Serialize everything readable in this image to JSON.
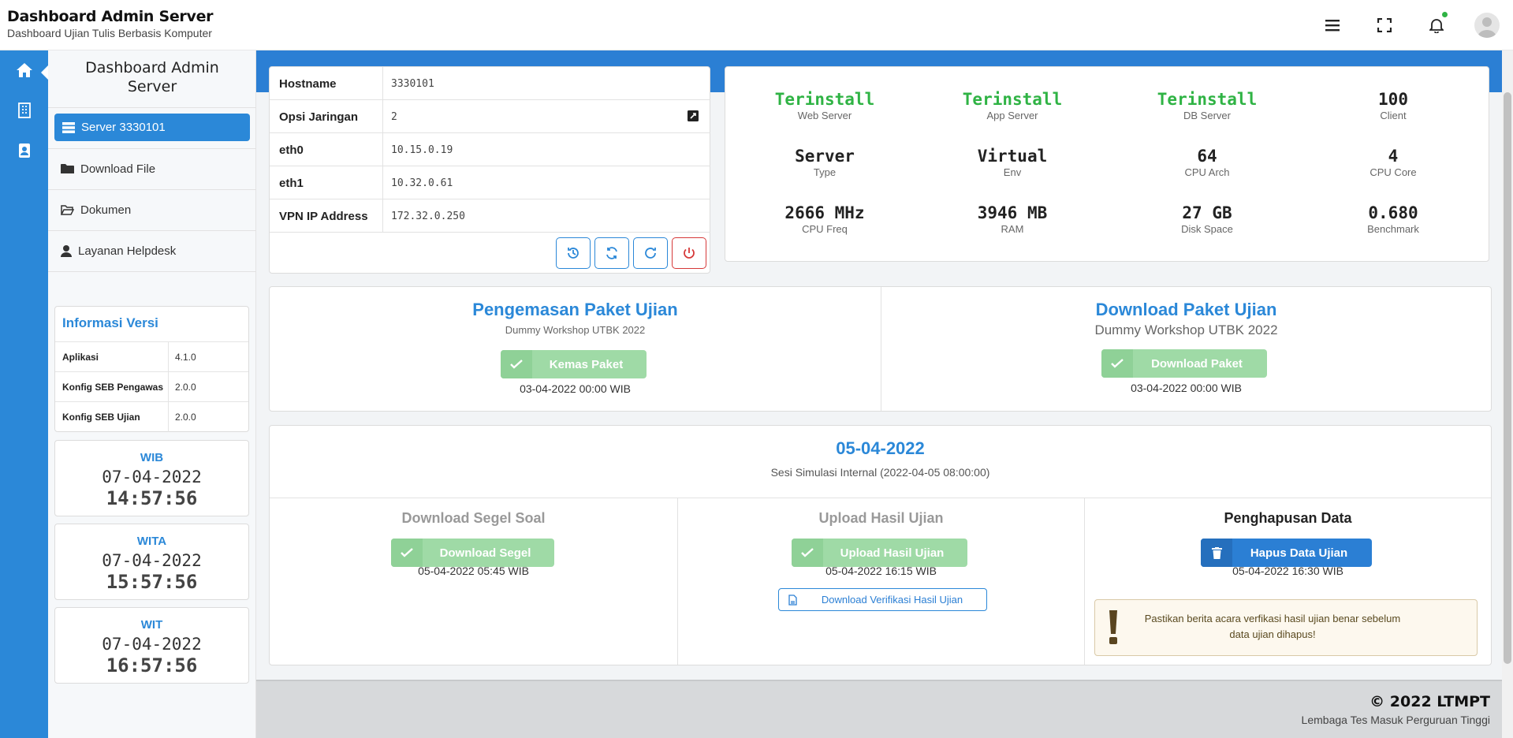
{
  "header": {
    "title": "Dashboard Admin Server",
    "subtitle": "Dashboard Ujian Tulis Berbasis Komputer",
    "icons": [
      "menu-icon",
      "fullscreen-icon",
      "bell-icon",
      "avatar"
    ]
  },
  "sidebar": {
    "title": "Dashboard Admin Server",
    "active_item": "Server 3330101",
    "items": [
      {
        "label": "Download File",
        "icon": "folder-icon"
      },
      {
        "label": "Dokumen",
        "icon": "folder-open-icon"
      },
      {
        "label": "Layanan Helpdesk",
        "icon": "user-headset-icon"
      }
    ],
    "version": {
      "title": "Informasi Versi",
      "rows": [
        {
          "key": "Aplikasi",
          "value": "4.1.0"
        },
        {
          "key": "Konfig SEB Pengawas",
          "value": "2.0.0"
        },
        {
          "key": "Konfig SEB Ujian",
          "value": "2.0.0"
        }
      ]
    },
    "clocks": [
      {
        "zone": "WIB",
        "date": "07-04-2022",
        "time": "14:57:56"
      },
      {
        "zone": "WITA",
        "date": "07-04-2022",
        "time": "15:57:56"
      },
      {
        "zone": "WIT",
        "date": "07-04-2022",
        "time": "16:57:56"
      }
    ]
  },
  "network": {
    "rows": [
      {
        "key": "Hostname",
        "value": "3330101"
      },
      {
        "key": "Opsi Jaringan",
        "value": "2"
      },
      {
        "key": "eth0",
        "value": "10.15.0.19"
      },
      {
        "key": "eth1",
        "value": "10.32.0.61"
      },
      {
        "key": "VPN IP Address",
        "value": "172.32.0.250"
      }
    ],
    "buttons": [
      "history-icon",
      "sync-icon",
      "redo-icon",
      "power-icon"
    ]
  },
  "stats": [
    {
      "value": "Terinstall",
      "label": "Web Server",
      "green": true
    },
    {
      "value": "Terinstall",
      "label": "App Server",
      "green": true
    },
    {
      "value": "Terinstall",
      "label": "DB Server",
      "green": true
    },
    {
      "value": "100",
      "label": "Client",
      "green": false
    },
    {
      "value": "Server",
      "label": "Type",
      "green": false
    },
    {
      "value": "Virtual",
      "label": "Env",
      "green": false
    },
    {
      "value": "64",
      "label": "CPU Arch",
      "green": false
    },
    {
      "value": "4",
      "label": "CPU Core",
      "green": false
    },
    {
      "value": "2666 MHz",
      "label": "CPU Freq",
      "green": false
    },
    {
      "value": "3946 MB",
      "label": "RAM",
      "green": false
    },
    {
      "value": "27 GB",
      "label": "Disk Space",
      "green": false
    },
    {
      "value": "0.680",
      "label": "Benchmark",
      "green": false
    }
  ],
  "package": {
    "left": {
      "title": "Pengemasan Paket Ujian",
      "subtitle": "Dummy Workshop UTBK 2022",
      "button": "Kemas Paket",
      "date": "03-04-2022 00:00 WIB"
    },
    "right": {
      "title": "Download Paket Ujian",
      "subtitle": "Dummy Workshop UTBK 2022",
      "button": "Download Paket",
      "date": "03-04-2022 00:00 WIB"
    }
  },
  "session": {
    "date": "05-04-2022",
    "subtitle": "Sesi Simulasi Internal (2022-04-05 08:00:00)",
    "segel": {
      "title": "Download Segel Soal",
      "button": "Download Segel",
      "date": "05-04-2022 05:45 WIB"
    },
    "upload": {
      "title": "Upload Hasil Ujian",
      "button": "Upload Hasil Ujian",
      "date": "05-04-2022 16:15 WIB",
      "verify": "Download Verifikasi Hasil Ujian"
    },
    "delete": {
      "title": "Penghapusan Data",
      "button": "Hapus Data Ujian",
      "date": "05-04-2022 16:30 WIB",
      "warning": "Pastikan berita acara verfikasi hasil ujian benar sebelum data ujian dihapus!"
    }
  },
  "footer": {
    "copyright": "© 2022 LTMPT",
    "org": "Lembaga Tes Masuk Perguruan Tinggi"
  },
  "colors": {
    "primary": "#2b88d8",
    "success": "#2fb344",
    "danger": "#d63939"
  }
}
